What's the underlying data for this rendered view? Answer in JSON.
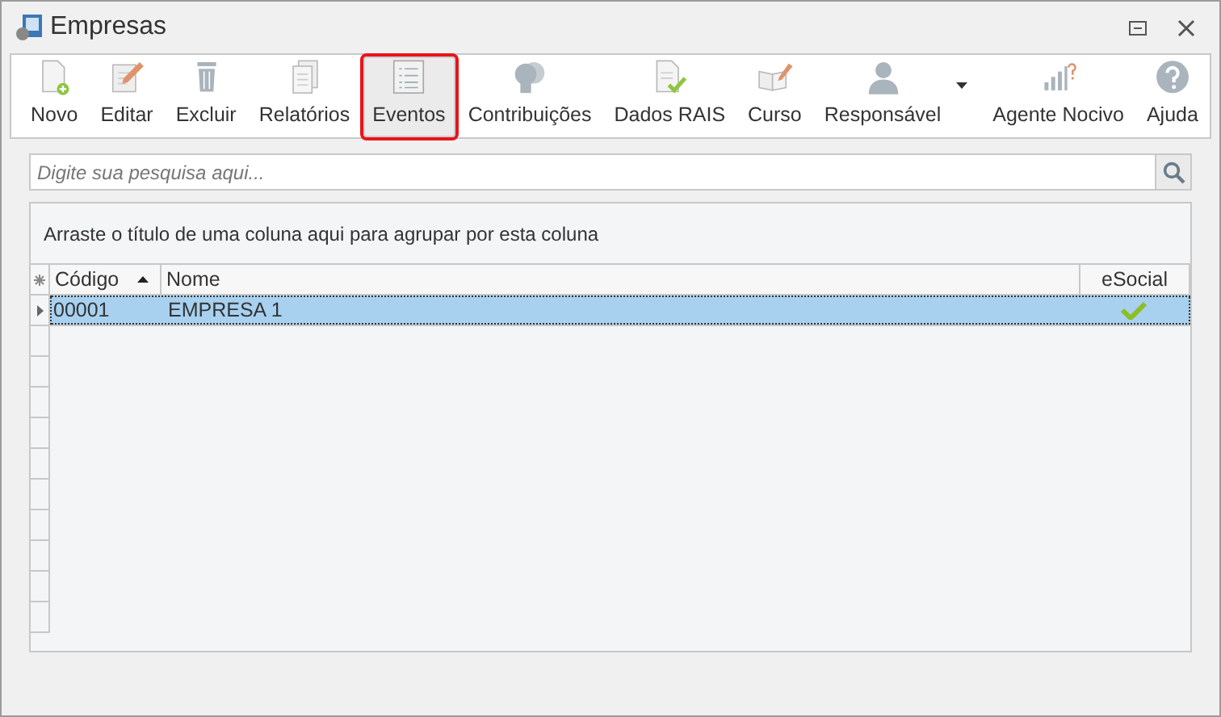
{
  "window": {
    "title": "Empresas"
  },
  "toolbar": [
    {
      "label": "Novo",
      "kind": "new",
      "highlighted": false,
      "dropdown": false
    },
    {
      "label": "Editar",
      "kind": "edit",
      "highlighted": false,
      "dropdown": false
    },
    {
      "label": "Excluir",
      "kind": "delete",
      "highlighted": false,
      "dropdown": false
    },
    {
      "label": "Relatórios",
      "kind": "reports",
      "highlighted": false,
      "dropdown": false
    },
    {
      "label": "Eventos",
      "kind": "events",
      "highlighted": true,
      "dropdown": false
    },
    {
      "label": "Contribuições",
      "kind": "contributions",
      "highlighted": false,
      "dropdown": false
    },
    {
      "label": "Dados RAIS",
      "kind": "rais",
      "highlighted": false,
      "dropdown": false
    },
    {
      "label": "Curso",
      "kind": "course",
      "highlighted": false,
      "dropdown": false
    },
    {
      "label": "Responsável",
      "kind": "person",
      "highlighted": false,
      "dropdown": true
    },
    {
      "label": "Agente Nocivo",
      "kind": "agent",
      "highlighted": false,
      "dropdown": false
    },
    {
      "label": "Ajuda",
      "kind": "help",
      "highlighted": false,
      "dropdown": false
    }
  ],
  "search": {
    "placeholder": "Digite sua pesquisa aqui..."
  },
  "grid": {
    "group_hint": "Arraste o título de uma coluna aqui para agrupar por esta coluna",
    "columns": [
      {
        "label": "Código",
        "sorted": true
      },
      {
        "label": "Nome",
        "sorted": false
      },
      {
        "label": "eSocial",
        "sorted": false
      }
    ],
    "rows": [
      {
        "codigo": "00001",
        "nome": "EMPRESA 1",
        "esocial": true,
        "selected": true
      }
    ]
  }
}
